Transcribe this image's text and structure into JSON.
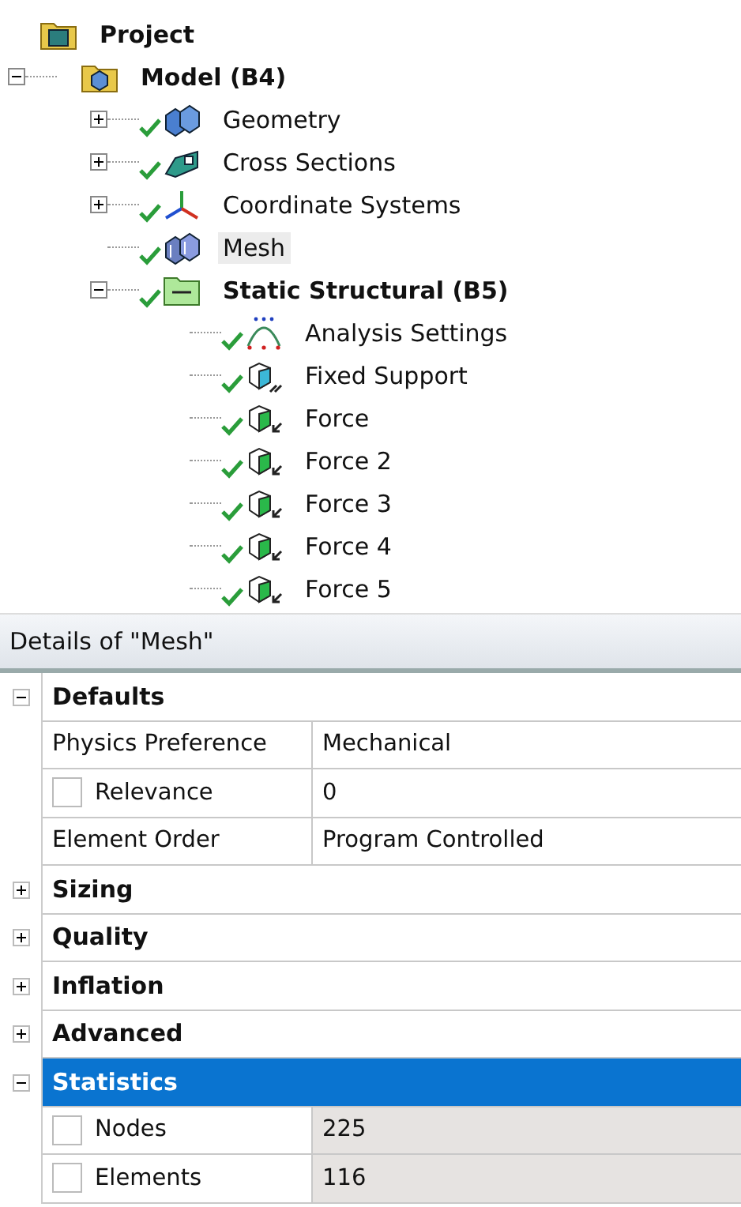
{
  "tree": [
    {
      "label": "Project",
      "kind": "project",
      "checked": false,
      "highlighted": false,
      "bold": true,
      "children": [
        {
          "label": "Model (B4)",
          "kind": "model",
          "checked": false,
          "expandable": true,
          "expanded": true,
          "highlighted": false,
          "bold": true,
          "children": [
            {
              "label": "Geometry",
              "kind": "geometry",
              "checked": true,
              "expandable": true,
              "expanded": false,
              "highlighted": false,
              "bold": false
            },
            {
              "label": "Cross Sections",
              "kind": "cross-section",
              "checked": true,
              "expandable": true,
              "expanded": false,
              "highlighted": false,
              "bold": false
            },
            {
              "label": "Coordinate Systems",
              "kind": "coordinates",
              "checked": true,
              "expandable": true,
              "expanded": false,
              "highlighted": false,
              "bold": false
            },
            {
              "label": "Mesh",
              "kind": "mesh",
              "checked": true,
              "expandable": false,
              "expanded": false,
              "highlighted": true,
              "bold": false
            },
            {
              "label": "Static Structural (B5)",
              "kind": "analysis",
              "checked": true,
              "expandable": true,
              "expanded": true,
              "highlighted": false,
              "bold": true,
              "children": [
                {
                  "label": "Analysis Settings",
                  "kind": "settings",
                  "checked": true,
                  "expandable": false,
                  "expanded": false,
                  "highlighted": false,
                  "bold": false
                },
                {
                  "label": "Fixed Support",
                  "kind": "support",
                  "checked": true,
                  "expandable": false,
                  "expanded": false,
                  "highlighted": false,
                  "bold": false
                },
                {
                  "label": "Force",
                  "kind": "force",
                  "checked": true,
                  "expandable": false,
                  "expanded": false,
                  "highlighted": false,
                  "bold": false
                },
                {
                  "label": "Force 2",
                  "kind": "force",
                  "checked": true,
                  "expandable": false,
                  "expanded": false,
                  "highlighted": false,
                  "bold": false
                },
                {
                  "label": "Force 3",
                  "kind": "force",
                  "checked": true,
                  "expandable": false,
                  "expanded": false,
                  "highlighted": false,
                  "bold": false
                },
                {
                  "label": "Force 4",
                  "kind": "force",
                  "checked": true,
                  "expandable": false,
                  "expanded": false,
                  "highlighted": false,
                  "bold": false
                },
                {
                  "label": "Force 5",
                  "kind": "force",
                  "checked": true,
                  "expandable": false,
                  "expanded": false,
                  "highlighted": false,
                  "bold": false
                }
              ]
            }
          ]
        }
      ]
    }
  ],
  "details": {
    "title": "Details of \"Mesh\"",
    "sections": [
      {
        "label": "Defaults",
        "expanded": true,
        "selected": false,
        "rows": [
          {
            "label": "Physics Preference",
            "value": "Mechanical",
            "kind": "plain",
            "readonly": false
          },
          {
            "label": "Relevance",
            "value": "0",
            "kind": "checkbox",
            "checked": false,
            "readonly": false
          },
          {
            "label": "Element Order",
            "value": "Program Controlled",
            "kind": "plain",
            "readonly": false
          }
        ]
      },
      {
        "label": "Sizing",
        "expanded": false,
        "selected": false
      },
      {
        "label": "Quality",
        "expanded": false,
        "selected": false
      },
      {
        "label": "Inflation",
        "expanded": false,
        "selected": false
      },
      {
        "label": "Advanced",
        "expanded": false,
        "selected": false
      },
      {
        "label": "Statistics",
        "expanded": true,
        "selected": true,
        "rows": [
          {
            "label": "Nodes",
            "value": "225",
            "kind": "checkbox",
            "checked": false,
            "readonly": true
          },
          {
            "label": "Elements",
            "value": "116",
            "kind": "checkbox",
            "checked": false,
            "readonly": true
          }
        ]
      }
    ]
  }
}
